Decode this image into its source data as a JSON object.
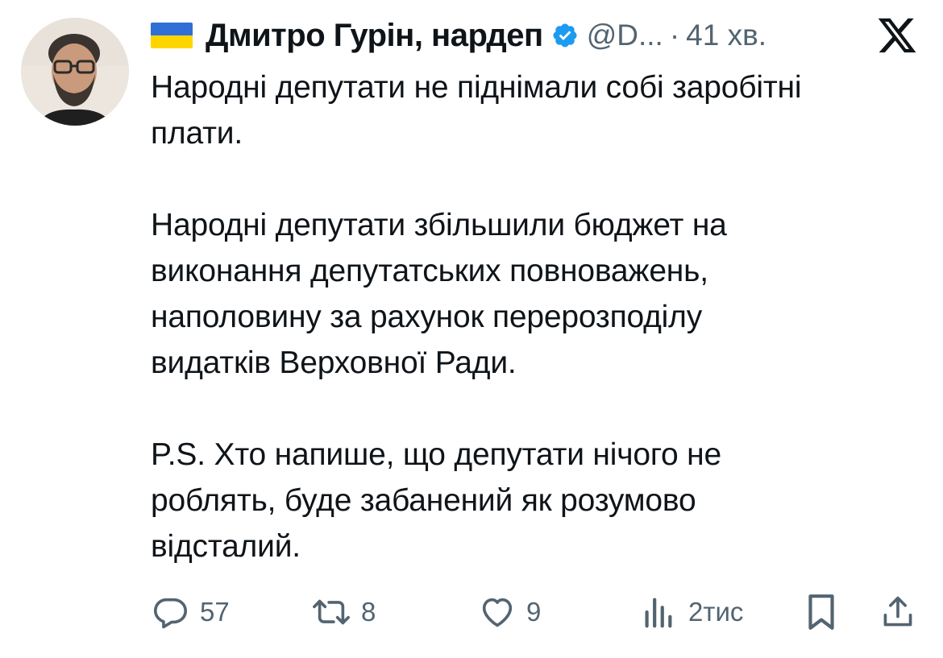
{
  "author": {
    "flag": "ukraine-flag",
    "name": "Дмитро Гурін, нардеп",
    "verified": true,
    "handle": "@D...",
    "separator": "·",
    "time": "41 хв."
  },
  "platform_icon": "x-logo-icon",
  "tweet": {
    "paragraphs": [
      "Народні депутати не піднімали собі заробітні\nплати.",
      "Народні депутати збільшили бюджет на\nвиконання депутатських повноважень,\nнаполовину за рахунок перерозподілу\nвидатків Верховної Ради.",
      "P.S. Хто напише, що депутати нічого не\nроблять, буде забанений як розумово\nвідсталий."
    ]
  },
  "actions": {
    "reply": {
      "icon": "reply-icon",
      "count": "57"
    },
    "repost": {
      "icon": "repost-icon",
      "count": "8"
    },
    "like": {
      "icon": "heart-icon",
      "count": "9"
    },
    "views": {
      "icon": "views-icon",
      "count": "2тис"
    },
    "bookmark": {
      "icon": "bookmark-icon"
    },
    "share": {
      "icon": "share-icon"
    }
  },
  "colors": {
    "text": "#0f1419",
    "secondary": "#536471",
    "verified_blue": "#1d9bf0",
    "flag_blue": "#2f6fd6",
    "flag_yellow": "#ffd500"
  }
}
